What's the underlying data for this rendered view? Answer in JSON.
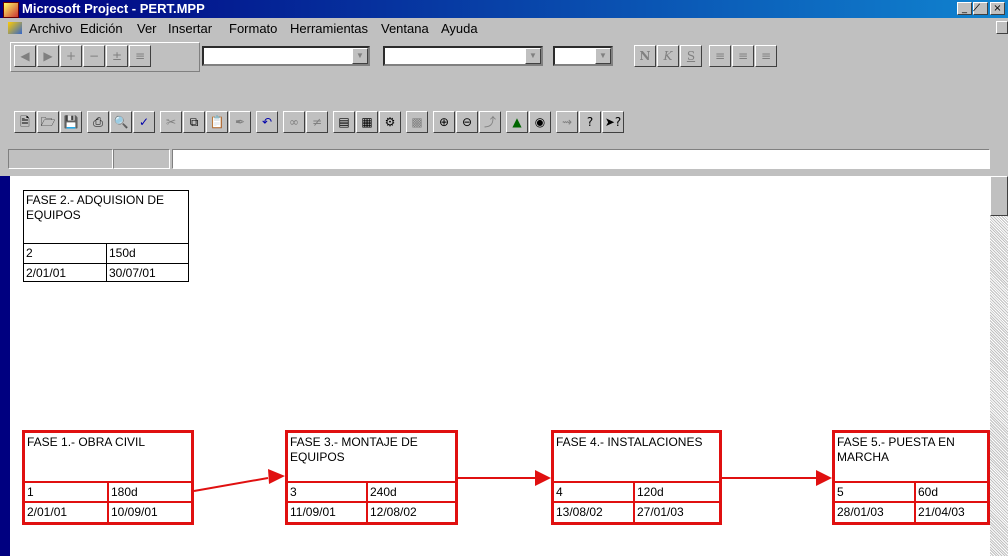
{
  "window": {
    "title": "Microsoft Project - PERT.MPP",
    "buttons": [
      "_",
      "̸",
      "×"
    ]
  },
  "menu": [
    {
      "label": "Archivo"
    },
    {
      "label": "Edición"
    },
    {
      "label": "Ver"
    },
    {
      "label": "Insertar"
    },
    {
      "label": "Formato"
    },
    {
      "label": "Herramientas"
    },
    {
      "label": "Ventana"
    },
    {
      "label": "Ayuda"
    }
  ],
  "formatting_toolbar": {
    "bold": "N",
    "italic": "K",
    "underline": "S"
  },
  "colors": {
    "critical": "#e01010",
    "normal": "#000000",
    "titlebar": "#000080"
  },
  "pert": {
    "nodes": [
      {
        "id": "fase2",
        "name": "FASE 2.- ADQUISION DE EQUIPOS",
        "number": "2",
        "duration": "150d",
        "start": "2/01/01",
        "finish": "30/07/01",
        "critical": false
      },
      {
        "id": "fase1",
        "name": "FASE 1.- OBRA CIVIL",
        "number": "1",
        "duration": "180d",
        "start": "2/01/01",
        "finish": "10/09/01",
        "critical": true
      },
      {
        "id": "fase3",
        "name": "FASE 3.- MONTAJE DE EQUIPOS",
        "number": "3",
        "duration": "240d",
        "start": "11/09/01",
        "finish": "12/08/02",
        "critical": true
      },
      {
        "id": "fase4",
        "name": "FASE 4.- INSTALACIONES",
        "number": "4",
        "duration": "120d",
        "start": "13/08/02",
        "finish": "27/01/03",
        "critical": true
      },
      {
        "id": "fase5",
        "name": "FASE 5.- PUESTA EN MARCHA",
        "number": "5",
        "duration": "60d",
        "start": "28/01/03",
        "finish": "21/04/03",
        "critical": true
      }
    ]
  }
}
